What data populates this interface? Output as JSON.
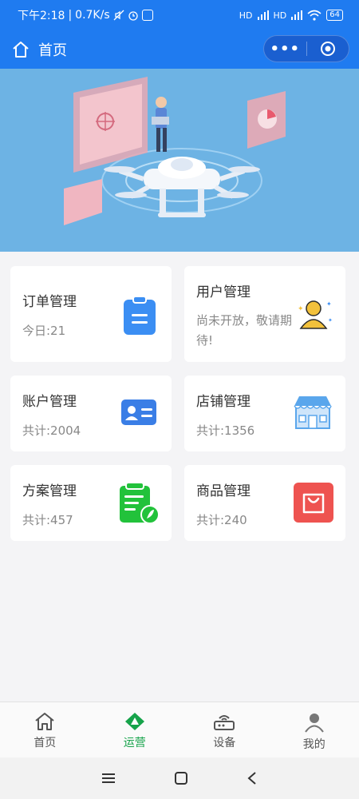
{
  "status_bar": {
    "time": "下午2:18",
    "speed": "0.7K/s",
    "battery": "64",
    "signal1": "HD",
    "signal2": "HD"
  },
  "nav": {
    "title": "首页",
    "more_icon": "more-dots-icon",
    "close_icon": "target-circle-icon"
  },
  "cards": [
    {
      "name": "订单管理",
      "stat": "今日:21",
      "icon": "clipboard-icon",
      "color": "#3b8ef3"
    },
    {
      "name": "用户管理",
      "stat": "尚未开放，敬请期待!",
      "icon": "user-stars-icon",
      "color": "#f2c13c"
    },
    {
      "name": "账户管理",
      "stat": "共计:2004",
      "icon": "id-card-icon",
      "color": "#3a7ee6"
    },
    {
      "name": "店铺管理",
      "stat": "共计:1356",
      "icon": "storefront-icon",
      "color": "#5aa6ec"
    },
    {
      "name": "方案管理",
      "stat": "共计:457",
      "icon": "plan-document-icon",
      "color": "#22c23b"
    },
    {
      "name": "商品管理",
      "stat": "共计:240",
      "icon": "shopping-bag-icon",
      "color": "#ee5350"
    }
  ],
  "tabbar": {
    "items": [
      {
        "label": "首页",
        "icon": "home-icon"
      },
      {
        "label": "运营",
        "icon": "operation-icon"
      },
      {
        "label": "设备",
        "icon": "router-icon"
      },
      {
        "label": "我的",
        "icon": "person-icon"
      }
    ],
    "active_color": "#16a34a"
  },
  "colors": {
    "primary": "#1f7bf0",
    "banner": "#6db3e4"
  }
}
